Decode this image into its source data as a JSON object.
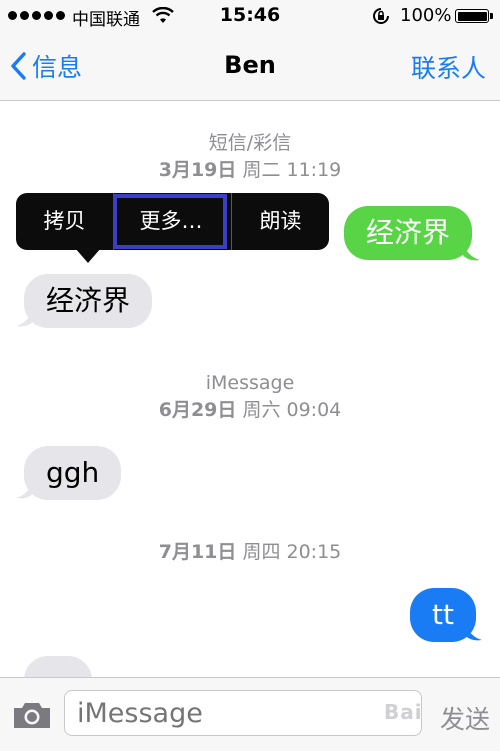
{
  "status_bar": {
    "carrier": "中国联通",
    "time": "15:46",
    "battery": "100%"
  },
  "nav": {
    "back_label": "信息",
    "title": "Ben",
    "contacts_label": "联系人"
  },
  "conversation": {
    "section1": {
      "service": "短信/彩信",
      "date": "3月19日",
      "weekday_time": "周二 11:19"
    },
    "popup_menu": {
      "items": [
        "拷贝",
        "更多…",
        "朗读"
      ],
      "highlighted": "更多…"
    },
    "sent_sms": "经济界",
    "received_sms": "经济界",
    "section2": {
      "service": "iMessage",
      "date": "6月29日",
      "weekday_time": "周六 09:04"
    },
    "received_imessage": "ggh",
    "section3": {
      "date": "7月11日",
      "weekday_time": "周四 20:15"
    },
    "sent_imessage": "tt"
  },
  "input_bar": {
    "placeholder": "iMessage",
    "send_label": "发送",
    "watermark": "Bai"
  },
  "colors": {
    "accent": "#1a7cf5",
    "sms_green": "#5ad447",
    "incoming_gray": "#e5e5ea",
    "highlight": "#3b3fc7"
  }
}
